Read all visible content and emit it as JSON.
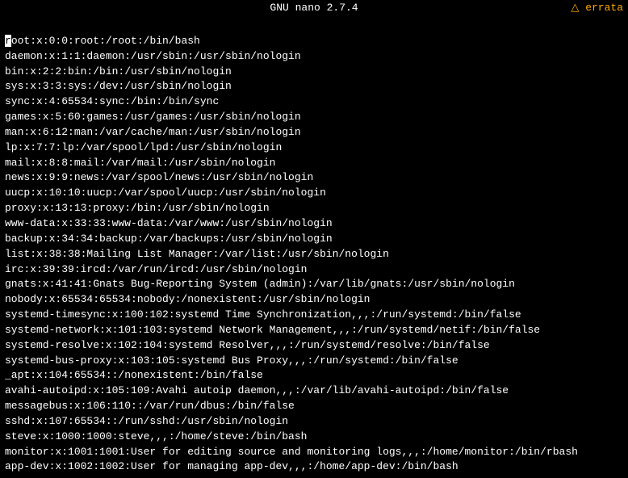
{
  "titlebar": {
    "title": "GNU nano 2.7.4"
  },
  "warning": {
    "text": "△ errata"
  },
  "lines": [
    "root:x:0:0:root:/root:/bin/bash",
    "daemon:x:1:1:daemon:/usr/sbin:/usr/sbin/nologin",
    "bin:x:2:2:bin:/bin:/usr/sbin/nologin",
    "sys:x:3:3:sys:/dev:/usr/sbin/nologin",
    "sync:x:4:65534:sync:/bin:/bin/sync",
    "games:x:5:60:games:/usr/games:/usr/sbin/nologin",
    "man:x:6:12:man:/var/cache/man:/usr/sbin/nologin",
    "lp:x:7:7:lp:/var/spool/lpd:/usr/sbin/nologin",
    "mail:x:8:8:mail:/var/mail:/usr/sbin/nologin",
    "news:x:9:9:news:/var/spool/news:/usr/sbin/nologin",
    "uucp:x:10:10:uucp:/var/spool/uucp:/usr/sbin/nologin",
    "proxy:x:13:13:proxy:/bin:/usr/sbin/nologin",
    "www-data:x:33:33:www-data:/var/www:/usr/sbin/nologin",
    "backup:x:34:34:backup:/var/backups:/usr/sbin/nologin",
    "list:x:38:38:Mailing List Manager:/var/list:/usr/sbin/nologin",
    "irc:x:39:39:ircd:/var/run/ircd:/usr/sbin/nologin",
    "gnats:x:41:41:Gnats Bug-Reporting System (admin):/var/lib/gnats:/usr/sbin/nologin",
    "nobody:x:65534:65534:nobody:/nonexistent:/usr/sbin/nologin",
    "systemd-timesync:x:100:102:systemd Time Synchronization,,,:/run/systemd:/bin/false",
    "systemd-network:x:101:103:systemd Network Management,,,:/run/systemd/netif:/bin/false",
    "systemd-resolve:x:102:104:systemd Resolver,,,:/run/systemd/resolve:/bin/false",
    "systemd-bus-proxy:x:103:105:systemd Bus Proxy,,,:/run/systemd:/bin/false",
    "_apt:x:104:65534::/nonexistent:/bin/false",
    "avahi-autoipd:x:105:109:Avahi autoip daemon,,,:/var/lib/avahi-autoipd:/bin/false",
    "messagebus:x:106:110::/var/run/dbus:/bin/false",
    "sshd:x:107:65534::/run/sshd:/usr/sbin/nologin",
    "steve:x:1000:1000:steve,,,:/home/steve:/bin/bash",
    "monitor:x:1001:1001:User for editing source and monitoring logs,,,:/home/monitor:/bin/rbash",
    "app-dev:x:1002:1002:User for managing app-dev,,,:/home/app-dev:/bin/bash"
  ],
  "bottom": {
    "text": ""
  }
}
